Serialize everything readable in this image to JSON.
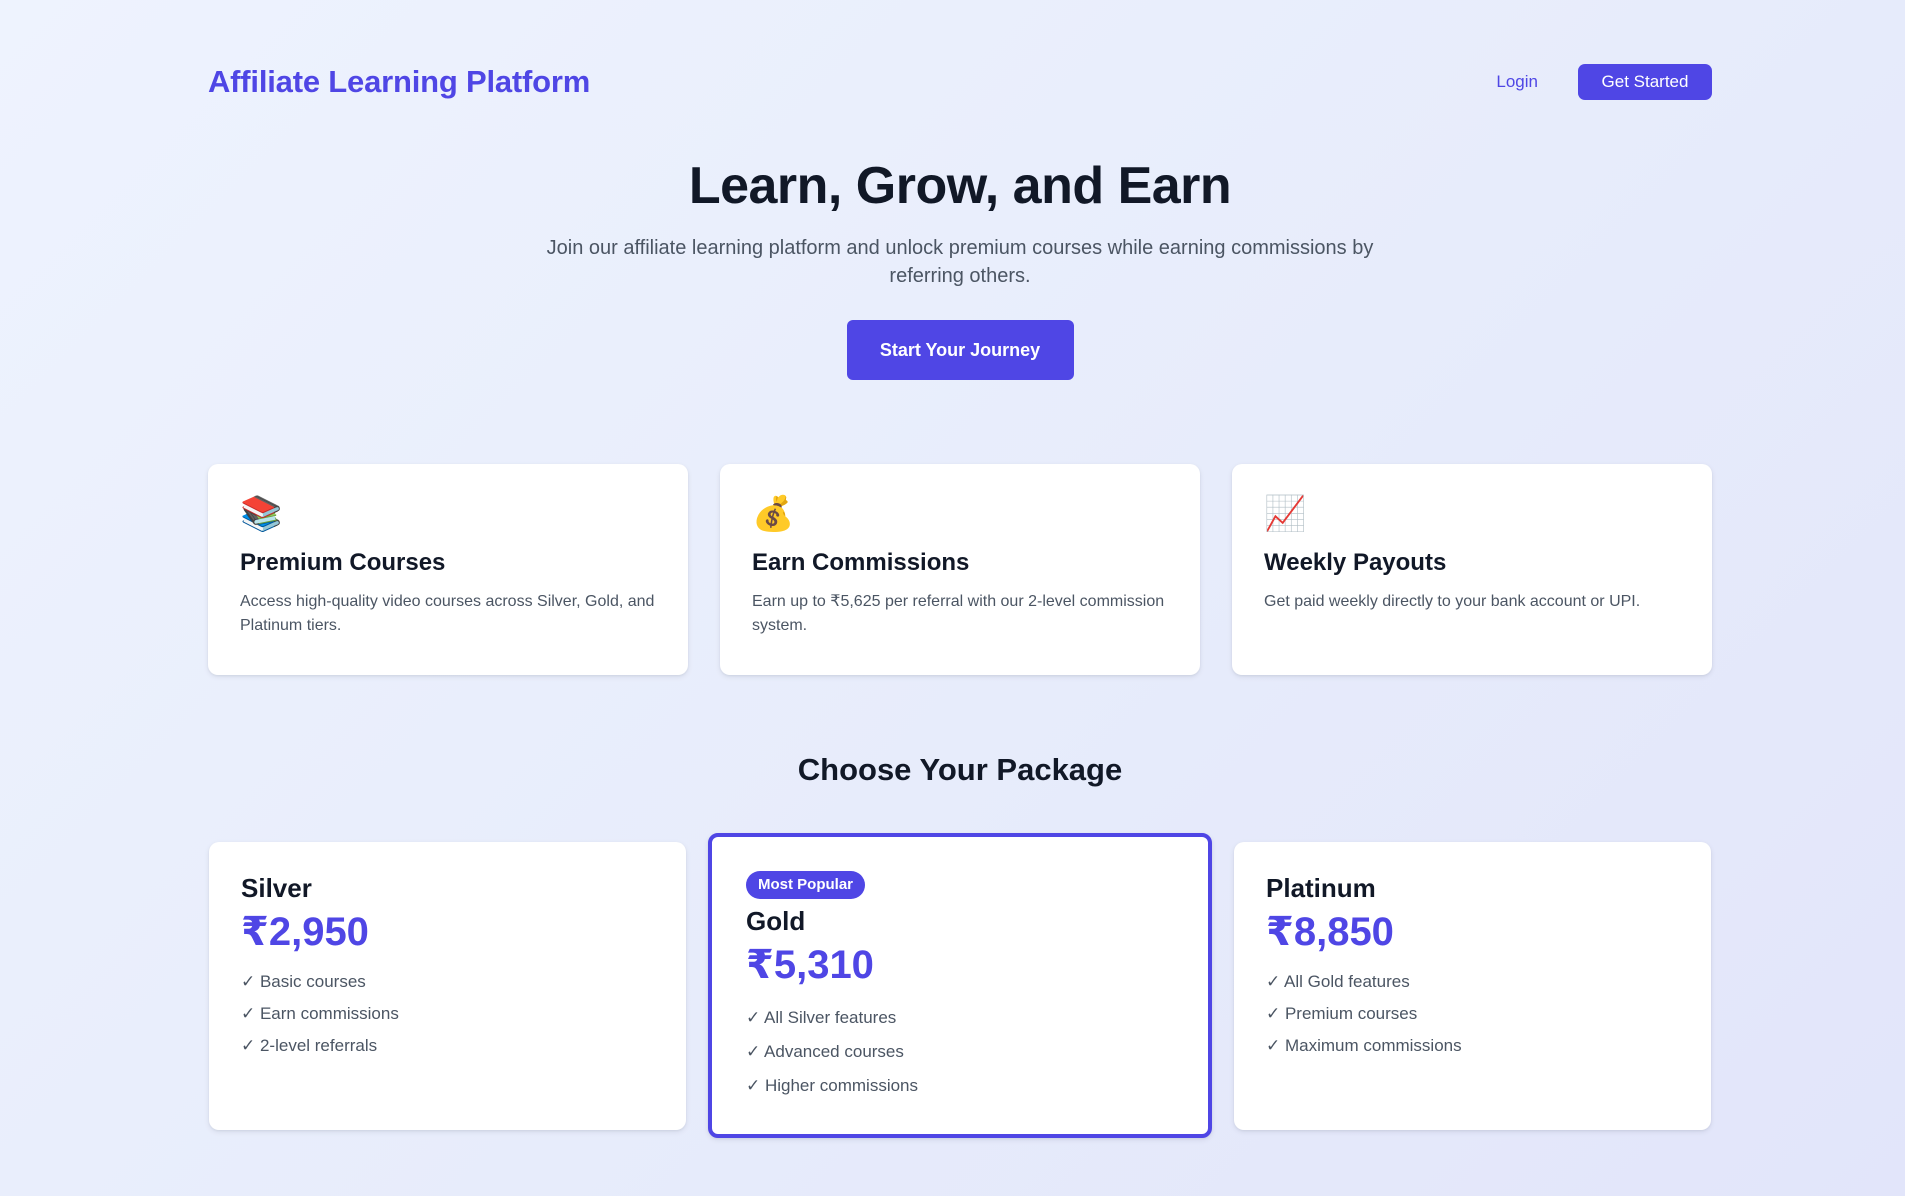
{
  "header": {
    "brand": "Affiliate Learning Platform",
    "login_label": "Login",
    "get_started_label": "Get Started"
  },
  "hero": {
    "title": "Learn, Grow, and Earn",
    "subtitle": "Join our affiliate learning platform and unlock premium courses while earning commissions by referring others.",
    "cta_label": "Start Your Journey"
  },
  "features": [
    {
      "icon": "📚",
      "icon_name": "books-icon",
      "title": "Premium Courses",
      "description": "Access high-quality video courses across Silver, Gold, and Platinum tiers."
    },
    {
      "icon": "💰",
      "icon_name": "money-bag-icon",
      "title": "Earn Commissions",
      "description": "Earn up to ₹5,625 per referral with our 2-level commission system."
    },
    {
      "icon": "📈",
      "icon_name": "chart-increasing-icon",
      "title": "Weekly Payouts",
      "description": "Get paid weekly directly to your bank account or UPI."
    }
  ],
  "packages_section": {
    "title": "Choose Your Package"
  },
  "packages": [
    {
      "name": "Silver",
      "price": "₹2,950",
      "features": [
        "✓ Basic courses",
        "✓ Earn commissions",
        "✓ 2-level referrals"
      ]
    },
    {
      "name": "Gold",
      "badge": "Most Popular",
      "price": "₹5,310",
      "features": [
        "✓ All Silver features",
        "✓ Advanced courses",
        "✓ Higher commissions"
      ]
    },
    {
      "name": "Platinum",
      "price": "₹8,850",
      "features": [
        "✓ All Gold features",
        "✓ Premium courses",
        "✓ Maximum commissions"
      ]
    }
  ],
  "colors": {
    "accent": "#4f46e5",
    "text_dark": "#111827",
    "text_muted": "#4b5563",
    "card_bg": "#ffffff"
  }
}
